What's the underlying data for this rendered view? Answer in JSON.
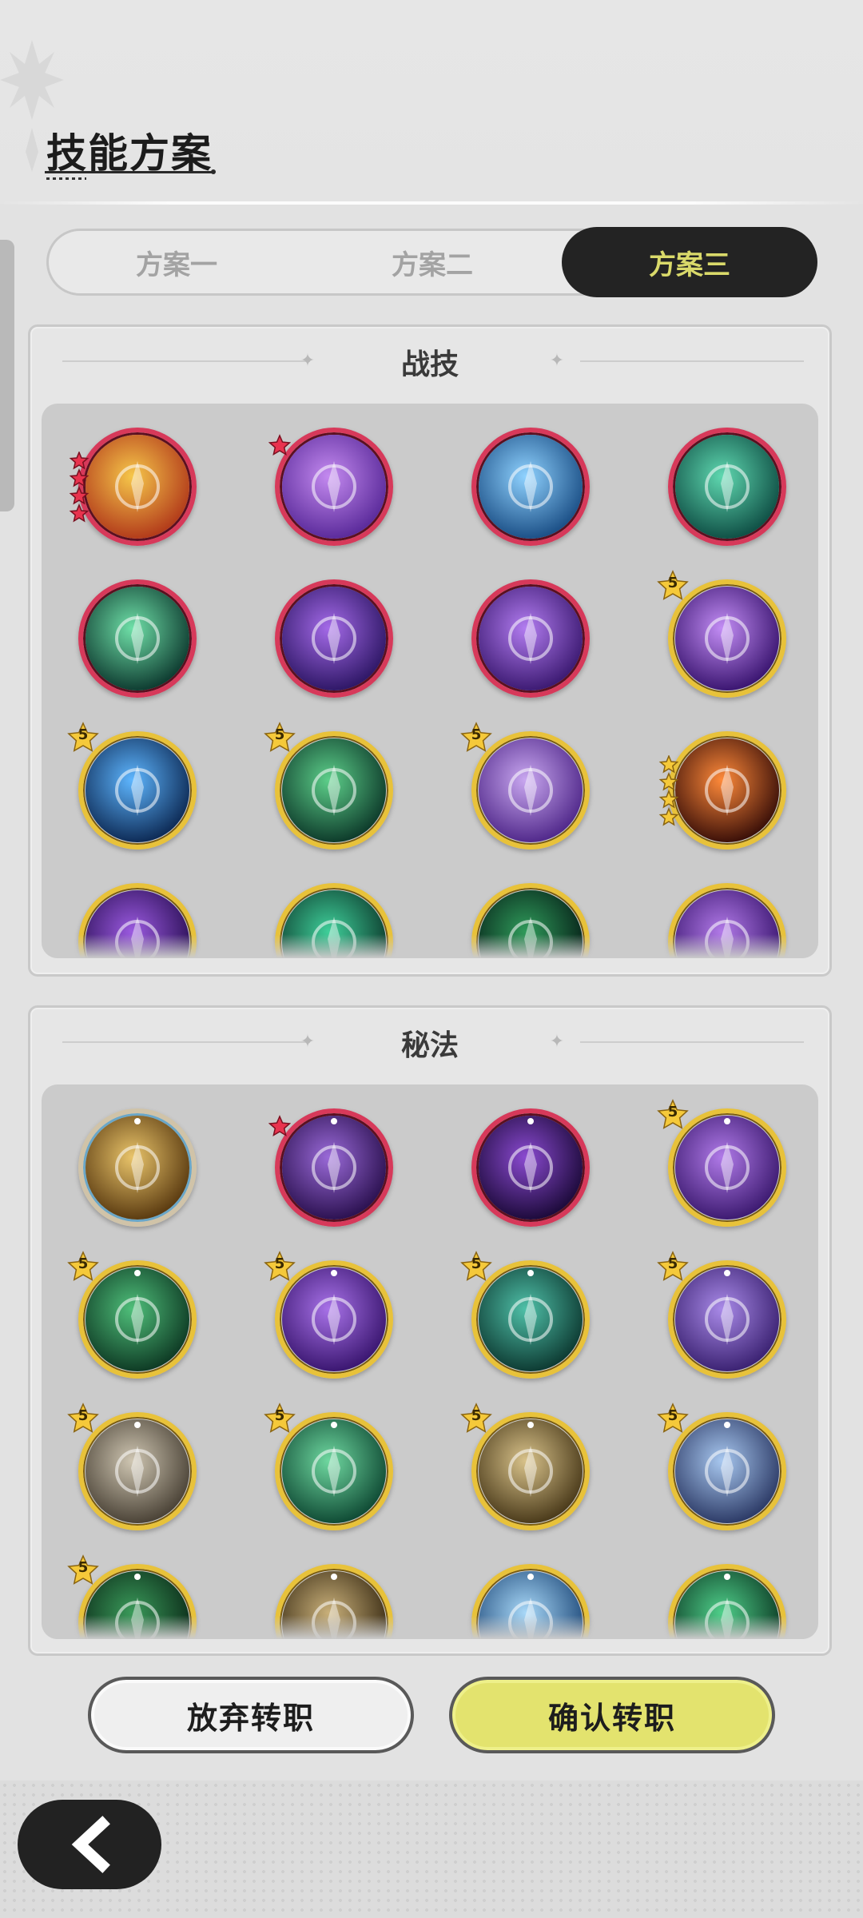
{
  "header": {
    "title": "技能方案"
  },
  "tabs": [
    {
      "label": "方案一",
      "selected": false
    },
    {
      "label": "方案二",
      "selected": false
    },
    {
      "label": "方案三",
      "selected": true
    }
  ],
  "sections": {
    "combat": {
      "title": "战技",
      "skills": [
        {
          "name": "fire-golem-skill-icon",
          "frame": "red",
          "badge": "red-star-stack",
          "colors": [
            "#f6c74a",
            "#b23a1a"
          ]
        },
        {
          "name": "purple-throne-skill-icon",
          "frame": "red",
          "badge": "red-star",
          "colors": [
            "#c48af0",
            "#5a2a9a"
          ]
        },
        {
          "name": "ice-burst-skill-icon",
          "frame": "red",
          "badge": "",
          "colors": [
            "#8fd2ff",
            "#1b4f86"
          ]
        },
        {
          "name": "green-vortex-skill-icon",
          "frame": "red",
          "badge": "",
          "colors": [
            "#5fd8b0",
            "#0f4f45"
          ]
        },
        {
          "name": "green-spirit-skill-icon",
          "frame": "red",
          "badge": "",
          "colors": [
            "#6fe0a8",
            "#0e3b30"
          ]
        },
        {
          "name": "purple-portal-skill-icon",
          "frame": "red",
          "badge": "",
          "colors": [
            "#a46ae8",
            "#2e1766"
          ]
        },
        {
          "name": "purple-shield-skill-icon",
          "frame": "red",
          "badge": "",
          "colors": [
            "#b27cf0",
            "#3c1a72"
          ]
        },
        {
          "name": "purple-rune-skill-icon",
          "frame": "gold",
          "badge": "5",
          "colors": [
            "#c38df5",
            "#3a1570"
          ]
        },
        {
          "name": "blue-flame-skill-icon",
          "frame": "gold",
          "badge": "5",
          "colors": [
            "#5eb6ff",
            "#0d2a55"
          ]
        },
        {
          "name": "thorn-ring-skill-icon",
          "frame": "gold",
          "badge": "5",
          "colors": [
            "#5dcf8a",
            "#0d3a2a"
          ]
        },
        {
          "name": "lotus-sigil-skill-icon",
          "frame": "gold",
          "badge": "5",
          "colors": [
            "#c9a7f0",
            "#50288a"
          ]
        },
        {
          "name": "fire-swirl-skill-icon",
          "frame": "gold",
          "badge": "gold-star-stack",
          "colors": [
            "#ff8a3a",
            "#3a0f08"
          ]
        },
        {
          "name": "purple-spike-skill-icon",
          "frame": "gold",
          "badge": "small-star",
          "colors": [
            "#9b5ae0",
            "#2a0f55"
          ]
        },
        {
          "name": "green-wave-skill-icon",
          "frame": "gold",
          "badge": "small-star",
          "colors": [
            "#3fcf9a",
            "#0c3a2c"
          ]
        },
        {
          "name": "green-heal-skill-icon",
          "frame": "gold",
          "badge": "small-star",
          "colors": [
            "#2f9a5a",
            "#062018"
          ]
        },
        {
          "name": "purple-mist-skill-icon",
          "frame": "gold",
          "badge": "small-star",
          "colors": [
            "#b27ae8",
            "#3a1670"
          ]
        }
      ]
    },
    "arcane": {
      "title": "秘法",
      "skills": [
        {
          "name": "golden-figure-arcane-icon",
          "frame": "silver",
          "badge": "",
          "colors": [
            "#e9c46a",
            "#5a3a10"
          ]
        },
        {
          "name": "purple-bird-arcane-icon",
          "frame": "red",
          "badge": "red-star",
          "colors": [
            "#9a6ad8",
            "#2b1150"
          ]
        },
        {
          "name": "purple-orb-arcane-icon",
          "frame": "red",
          "badge": "",
          "colors": [
            "#8a4ad0",
            "#1c0a3a"
          ]
        },
        {
          "name": "purple-bloom-arcane-icon",
          "frame": "gold",
          "badge": "5",
          "colors": [
            "#b07ae8",
            "#3c1a70"
          ]
        },
        {
          "name": "green-wings-arcane-icon",
          "frame": "gold",
          "badge": "5",
          "colors": [
            "#4fbf7a",
            "#0e3a24"
          ]
        },
        {
          "name": "purple-heart-arcane-icon",
          "frame": "gold",
          "badge": "5",
          "colors": [
            "#a872e8",
            "#3a1670"
          ]
        },
        {
          "name": "teal-figure-arcane-icon",
          "frame": "gold",
          "badge": "5",
          "colors": [
            "#4fc0a8",
            "#0d3a32"
          ]
        },
        {
          "name": "purple-eye-arcane-icon",
          "frame": "gold",
          "badge": "5",
          "colors": [
            "#a98ae8",
            "#3b2272"
          ]
        },
        {
          "name": "stone-figure-arcane-icon",
          "frame": "gold",
          "badge": "5",
          "colors": [
            "#cfc6b2",
            "#4a4236"
          ]
        },
        {
          "name": "green-clover-arcane-icon",
          "frame": "gold",
          "badge": "5",
          "colors": [
            "#6fd8a0",
            "#0f4a34"
          ]
        },
        {
          "name": "golden-tree-arcane-icon",
          "frame": "gold",
          "badge": "5",
          "colors": [
            "#d8c28a",
            "#4a3a1a"
          ]
        },
        {
          "name": "blue-star-arcane-icon",
          "frame": "gold",
          "badge": "5",
          "colors": [
            "#a8c8f0",
            "#2c3a66"
          ]
        },
        {
          "name": "green-tower-arcane-icon",
          "frame": "gold",
          "badge": "5",
          "colors": [
            "#3a9a5a",
            "#0b2a18"
          ]
        },
        {
          "name": "golden-arrow-arcane-icon",
          "frame": "gold",
          "badge": "small-star",
          "colors": [
            "#c9b07a",
            "#3a2c14"
          ]
        },
        {
          "name": "ice-crystal-arcane-icon",
          "frame": "gold",
          "badge": "small-star",
          "colors": [
            "#a8d8f8",
            "#1f4a7a"
          ]
        },
        {
          "name": "green-heart-arcane-icon",
          "frame": "gold",
          "badge": "small-star",
          "colors": [
            "#4fcf8a",
            "#0c3a24"
          ]
        }
      ]
    }
  },
  "buttons": {
    "abandon": "放弃转职",
    "confirm": "确认转职"
  },
  "back_icon": "chevron-left-icon",
  "accent": {
    "selected_tab_bg": "#232323",
    "selected_tab_text": "#d9d96a",
    "confirm_bg": "#e3e36e"
  }
}
